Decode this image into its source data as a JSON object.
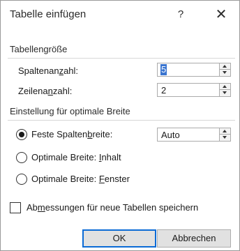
{
  "dialog": {
    "title": "Tabelle einfügen",
    "help": "?",
    "close": "✕"
  },
  "size_group": {
    "label": "Tabellengröße",
    "columns": {
      "label_pre": "Spaltenan",
      "label_u": "z",
      "label_post": "ahl:",
      "value": "5"
    },
    "rows": {
      "label_pre": "Zeilena",
      "label_u": "n",
      "label_post": "zahl:",
      "value": "2"
    }
  },
  "width_group": {
    "label": "Einstellung für optimale Breite",
    "fixed": {
      "label_pre": "Feste Spalten",
      "label_u": "b",
      "label_post": "reite:",
      "value": "Auto",
      "selected": true
    },
    "content": {
      "label_pre": "Optimale Breite: ",
      "label_u": "I",
      "label_post": "nhalt",
      "selected": false
    },
    "window": {
      "label_pre": "Optimale Breite: ",
      "label_u": "F",
      "label_post": "enster",
      "selected": false
    }
  },
  "remember": {
    "label_pre": "Ab",
    "label_u": "m",
    "label_post": "essungen für neue Tabellen speichern",
    "checked": false
  },
  "buttons": {
    "ok": "OK",
    "cancel": "Abbrechen"
  }
}
